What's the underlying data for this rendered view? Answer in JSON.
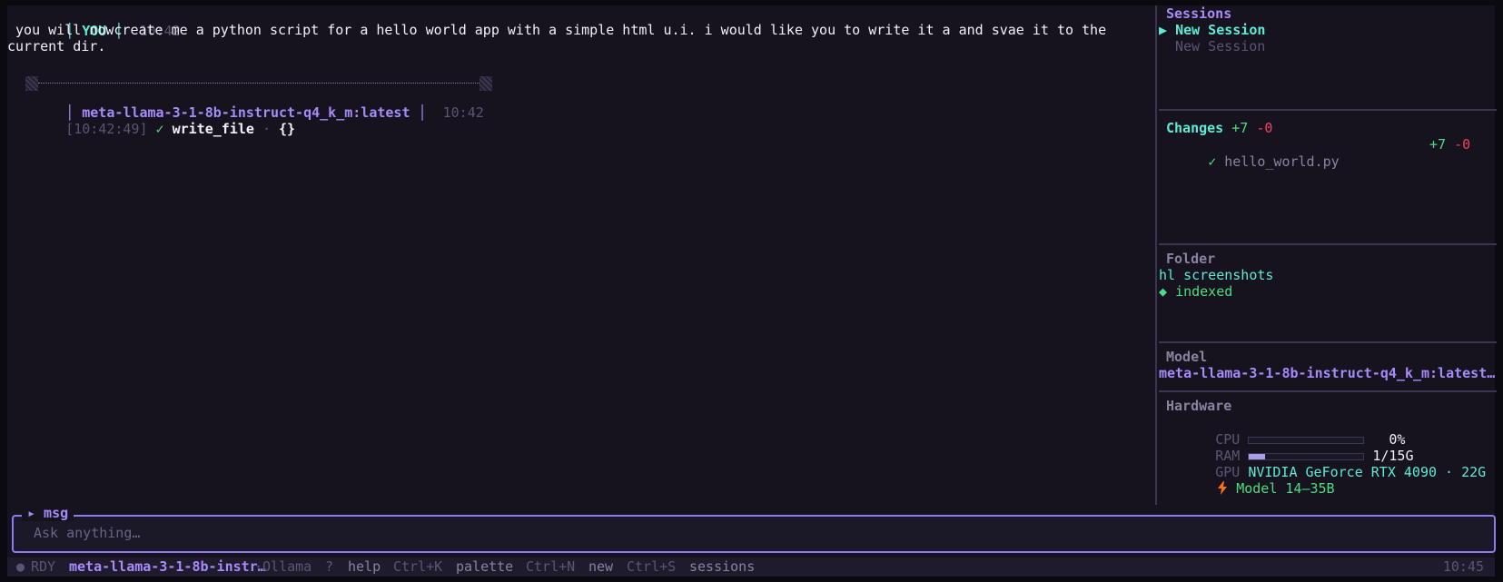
{
  "chat": {
    "user_tag": "YOU",
    "user_time": "10:42",
    "user_msg_line1": " you will nowcreate me a python script for a hello world app with a simple html u.i. i would like you to write it a and svae it to the",
    "user_msg_line2": "current dir.",
    "model_name": "meta-llama-3-1-8b-instruct-q4_k_m:latest",
    "model_time": "10:42",
    "tool_timestamp": "[10:42:49]",
    "tool_check": "✓",
    "tool_name": "write_file",
    "tool_sep": "·",
    "tool_args": "{}"
  },
  "sidebar": {
    "sessions_title": "Sessions",
    "sessions": [
      {
        "marker": "▶",
        "label": "New Session"
      },
      {
        "marker": "",
        "label": "New Session"
      }
    ],
    "changes_title": "Changes",
    "changes_add": "+7",
    "changes_del": "-0",
    "files": [
      {
        "check": "✓",
        "name": "hello_world.py",
        "add": "+7",
        "del": "-0"
      }
    ],
    "folder_title": "Folder",
    "folder_name": "hl screenshots",
    "folder_status_icon": "◆",
    "folder_status": "indexed",
    "model_title": "Model",
    "model_name": "meta-llama-3-1-8b-instruct-q4_k_m:latest…",
    "hardware_title": "Hardware",
    "cpu_label": "CPU",
    "cpu_value": "0%",
    "cpu_level": 0.0,
    "ram_label": "RAM",
    "ram_value": "1/15G",
    "ram_level": 0.14,
    "gpu_label": "GPU",
    "gpu_value": "NVIDIA GeForce RTX 4090 · 22G",
    "model_range_icon": "lightning-icon",
    "model_range": "Model 14–35B"
  },
  "input": {
    "label": "▸ msg",
    "placeholder": "Ask anything…"
  },
  "status": {
    "dot": "●",
    "state": "RDY",
    "model": "meta-llama-3-1-8b-instr…",
    "provider": "·Ollama",
    "help_key": "?",
    "help_label": "help",
    "palette_key": "Ctrl+K",
    "palette_label": "palette",
    "new_key": "Ctrl+N",
    "new_label": "new",
    "sessions_key": "Ctrl+S",
    "sessions_label": "sessions",
    "clock": "10:45"
  },
  "colors": {
    "accent": "#a78bfa",
    "cyan": "#5eead4",
    "green": "#4ade80",
    "red": "#f43f5e",
    "background": "#16131f"
  }
}
